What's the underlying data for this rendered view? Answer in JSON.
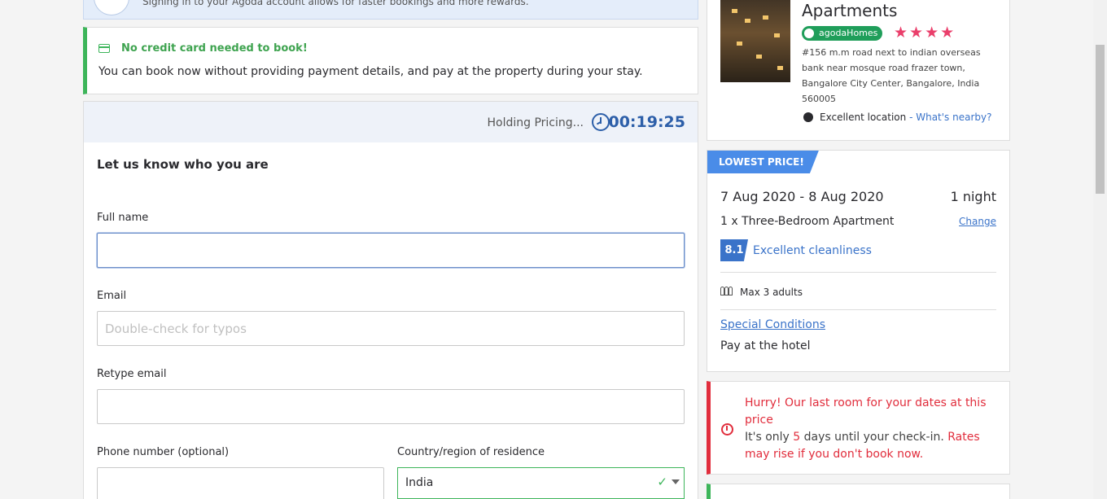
{
  "signin_banner": {
    "text": "Signing in to your Agoda account allows for faster bookings and more rewards."
  },
  "no_card": {
    "title": "No credit card needed to book!",
    "description": "You can book now without providing payment details, and pay at the property during your stay."
  },
  "hold": {
    "label": "Holding Pricing...",
    "timer": "00:19:25"
  },
  "form": {
    "heading": "Let us know who you are",
    "full_name": {
      "label": "Full name",
      "value": "",
      "placeholder": ""
    },
    "email": {
      "label": "Email",
      "value": "",
      "placeholder": "Double-check for typos"
    },
    "retype_email": {
      "label": "Retype email",
      "value": "",
      "placeholder": ""
    },
    "phone": {
      "label": "Phone number (optional)",
      "value": "",
      "placeholder": ""
    },
    "country": {
      "label": "Country/region of residence",
      "value": "India",
      "check": "✓"
    }
  },
  "hotel": {
    "name": "Apartments",
    "badge": "agodaHomes",
    "stars": "★★★★",
    "address": "#156 m.m road next to indian overseas bank near mosque road frazer town, Bangalore City Center, Bangalore, India 560005",
    "location_label": "Excellent location",
    "location_sep": " - ",
    "nearby_link": "What's nearby?"
  },
  "booking": {
    "badge": "LOWEST PRICE!",
    "dates": "7 Aug 2020 - 8 Aug 2020",
    "nights": "1 night",
    "room": "1 x Three-Bedroom Apartment",
    "change_link": "Change",
    "score": "8.1",
    "score_label": "Excellent cleanliness",
    "max_guests": "Max 3 adults",
    "special_conditions": "Special Conditions",
    "payment": "Pay at the hotel"
  },
  "hurry": {
    "title": "Hurry! Our last room for your dates at this price",
    "desc_prefix": "It's only ",
    "days": "5",
    "desc_mid": " days until your check-in. ",
    "desc_red": "Rates may rise if you don't book now."
  },
  "colors": {
    "accent_blue": "#3a73c9",
    "success_green": "#3db55a",
    "alert_red": "#e12d3c",
    "star_pink": "#ea3f6b"
  }
}
